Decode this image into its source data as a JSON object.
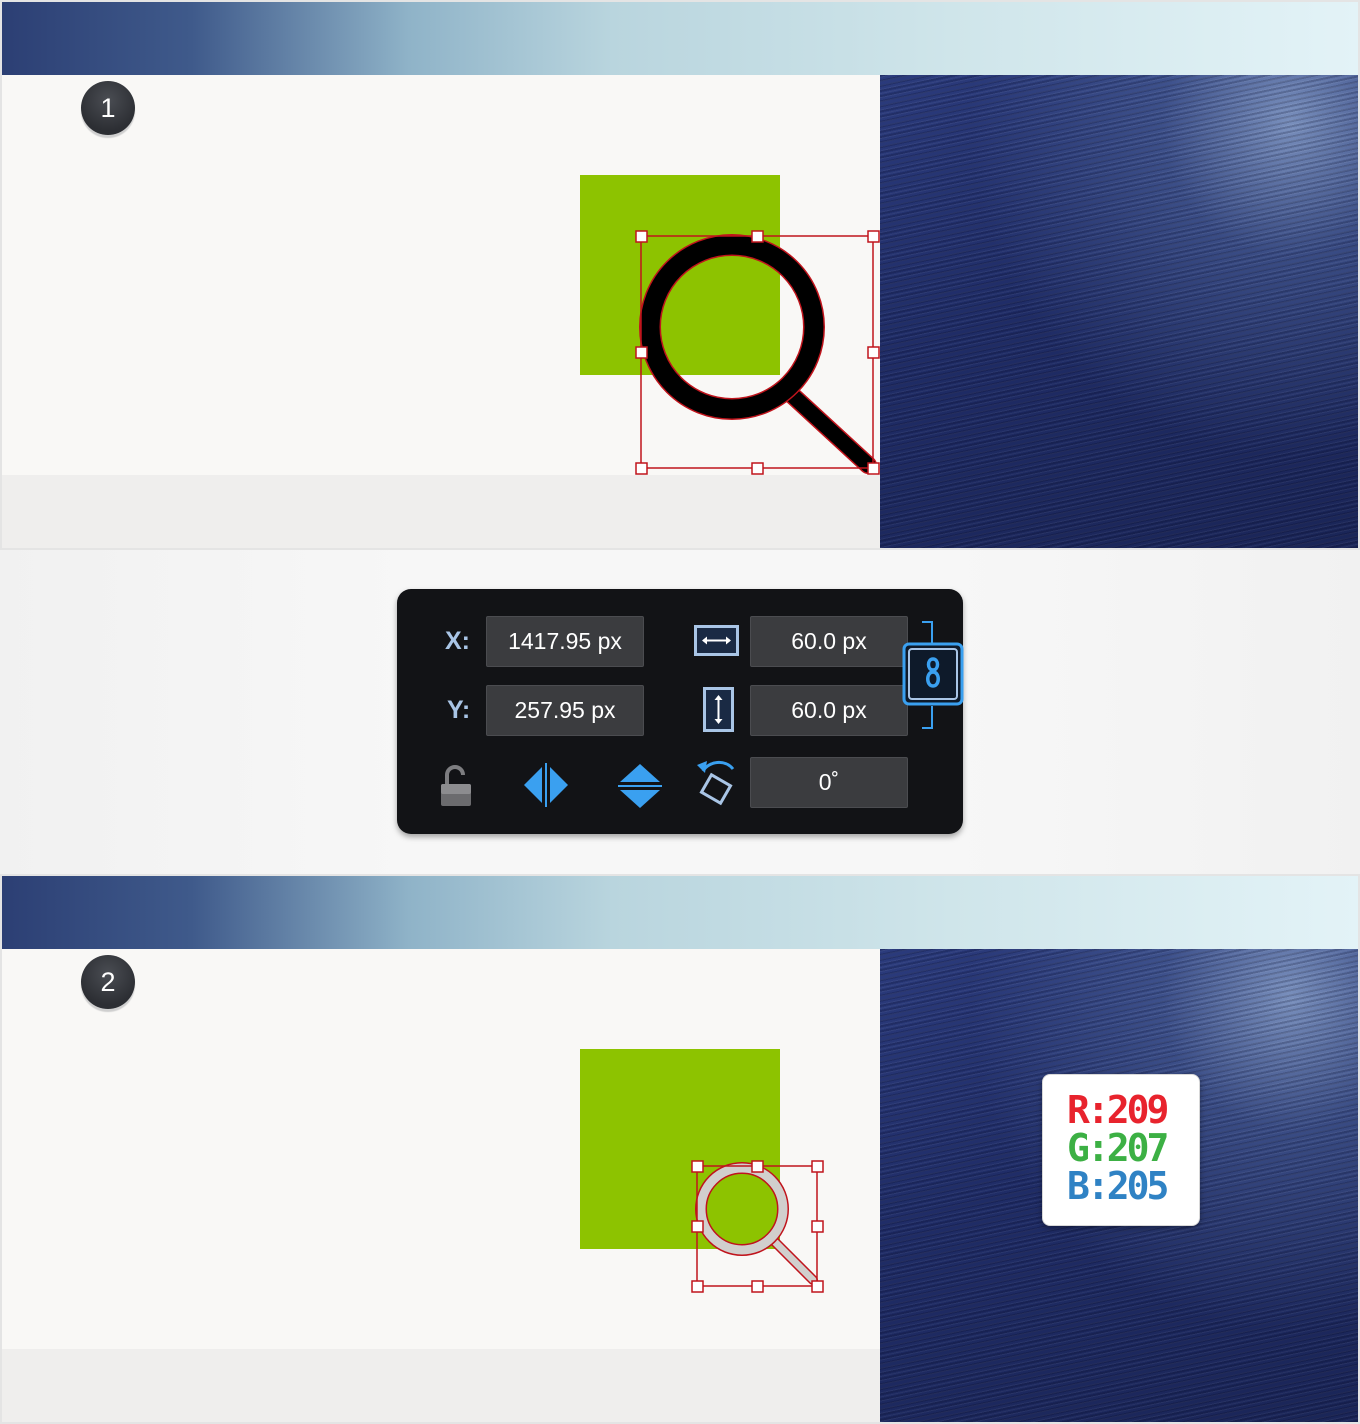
{
  "steps": [
    {
      "number": "1"
    },
    {
      "number": "2"
    }
  ],
  "transform_panel": {
    "x_label": "X:",
    "x_value": "1417.95 px",
    "y_label": "Y:",
    "y_value": "257.95 px",
    "width_value": "60.0 px",
    "height_value": "60.0 px",
    "rotation_value": "0˚",
    "icons": [
      "width-icon",
      "height-icon",
      "link-proportions-icon",
      "lock-icon",
      "flip-horizontal-icon",
      "flip-vertical-icon",
      "rotate-icon"
    ],
    "accent_color": "#3aa0f0"
  },
  "color_readout": {
    "r": "R:209",
    "g": "G:207",
    "b": "B:205",
    "r_color": "#e8232d",
    "g_color": "#3cb044",
    "b_color": "#2f82c4"
  },
  "colors": {
    "green_square": "#8dc300",
    "selection": "#c0141c",
    "icon_fill_step1": "#000000",
    "icon_fill_step2": "#d1cfcd"
  }
}
